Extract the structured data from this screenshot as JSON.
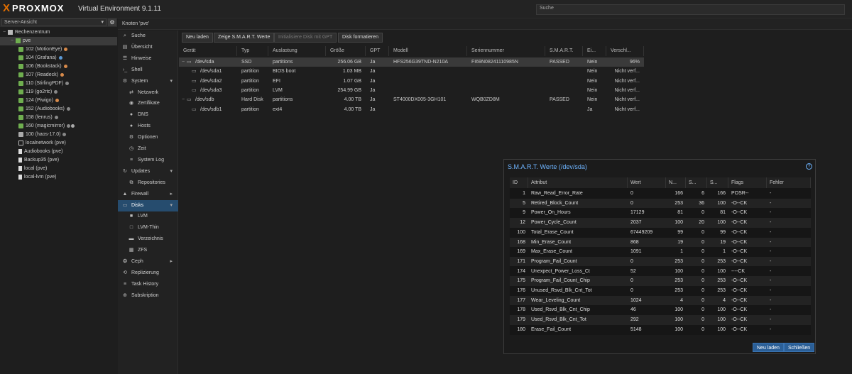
{
  "app": {
    "logo_text": "PROXMOX",
    "logo_mark": "X",
    "version": "Virtual Environment 9.1.11",
    "search_placeholder": "Suche"
  },
  "tree": {
    "view_select": "Server-Ansicht",
    "items": [
      {
        "label": "Rechenzentrum",
        "icon": "datacenter-icon",
        "indent": 0
      },
      {
        "label": "pve",
        "icon": "node-icon",
        "indent": 1,
        "selected": true
      },
      {
        "label": "102 (MotionEye)",
        "icon": "container-icon",
        "indent": 2,
        "dot": "#d88a4a"
      },
      {
        "label": "104 (Grafana)",
        "icon": "container-icon",
        "indent": 2,
        "dot": "#5c9ad6"
      },
      {
        "label": "106 (Bookstack)",
        "icon": "container-icon",
        "indent": 2,
        "dot": "#d88a4a"
      },
      {
        "label": "107 (Readeck)",
        "icon": "container-icon",
        "indent": 2,
        "dot": "#d88a4a"
      },
      {
        "label": "110 (StirlingPDF)",
        "icon": "container-icon",
        "indent": 2,
        "dot": "#888888"
      },
      {
        "label": "119 (go2rtc)",
        "icon": "container-icon",
        "indent": 2,
        "dot": "#888888"
      },
      {
        "label": "124 (Piwigo)",
        "icon": "container-icon",
        "indent": 2,
        "dot": "#d88a4a"
      },
      {
        "label": "152 (Audiobooks)",
        "icon": "container-icon",
        "indent": 2,
        "dot": "#888888"
      },
      {
        "label": "158 (fenrus)",
        "icon": "container-icon",
        "indent": 2,
        "dot": "#888888"
      },
      {
        "label": "160 (magicmirror)",
        "icon": "container-icon",
        "indent": 2,
        "dot": "#888888",
        "dot2": "#aaaaaa"
      },
      {
        "label": "100 (haos-17.0)",
        "icon": "vm-icon",
        "indent": 2,
        "dot": "#888888"
      },
      {
        "label": "localnetwork (pve)",
        "icon": "network-icon",
        "indent": 2
      },
      {
        "label": "Audiobooks (pve)",
        "icon": "storage-icon",
        "indent": 2
      },
      {
        "label": "Backup35 (pve)",
        "icon": "storage-icon",
        "indent": 2
      },
      {
        "label": "local (pve)",
        "icon": "storage-icon",
        "indent": 2
      },
      {
        "label": "local-lvm (pve)",
        "icon": "storage-icon",
        "indent": 2
      }
    ]
  },
  "nav": {
    "title": "Knoten 'pve'",
    "items": [
      {
        "label": "Suche",
        "icon": "search-icon",
        "sub": false
      },
      {
        "label": "Übersicht",
        "icon": "summary-icon",
        "sub": false
      },
      {
        "label": "Hinweise",
        "icon": "notes-icon",
        "sub": false
      },
      {
        "label": "Shell",
        "icon": "terminal-icon",
        "sub": false
      },
      {
        "label": "System",
        "icon": "gear-icon",
        "sub": false,
        "chevron": "down"
      },
      {
        "label": "Netzwerk",
        "icon": "network-icon",
        "sub": true
      },
      {
        "label": "Zertifikate",
        "icon": "certificate-icon",
        "sub": true
      },
      {
        "label": "DNS",
        "icon": "globe-icon",
        "sub": true
      },
      {
        "label": "Hosts",
        "icon": "globe-icon",
        "sub": true
      },
      {
        "label": "Optionen",
        "icon": "gear-icon",
        "sub": true
      },
      {
        "label": "Zeit",
        "icon": "clock-icon",
        "sub": true
      },
      {
        "label": "System Log",
        "icon": "list-icon",
        "sub": true
      },
      {
        "label": "Updates",
        "icon": "refresh-icon",
        "sub": false,
        "chevron": "down"
      },
      {
        "label": "Repositories",
        "icon": "repository-icon",
        "sub": true
      },
      {
        "label": "Firewall",
        "icon": "shield-icon",
        "sub": false,
        "chevron": "right"
      },
      {
        "label": "Disks",
        "icon": "disk-icon",
        "sub": false,
        "chevron": "down",
        "selected": true
      },
      {
        "label": "LVM",
        "icon": "square-icon",
        "sub": true
      },
      {
        "label": "LVM-Thin",
        "icon": "square-outline-icon",
        "sub": true
      },
      {
        "label": "Verzeichnis",
        "icon": "folder-icon",
        "sub": true
      },
      {
        "label": "ZFS",
        "icon": "grid-icon",
        "sub": true
      },
      {
        "label": "Ceph",
        "icon": "ceph-icon",
        "sub": false,
        "chevron": "right"
      },
      {
        "label": "Replizierung",
        "icon": "replicate-icon",
        "sub": false
      },
      {
        "label": "Task History",
        "icon": "list-icon",
        "sub": false
      },
      {
        "label": "Subskription",
        "icon": "support-icon",
        "sub": false
      }
    ]
  },
  "toolbar": {
    "reload": "Neu laden",
    "show_smart": "Zeige S.M.A.R.T. Werte",
    "init_gpt": "Initialisiere Disk mit GPT",
    "wipe": "Disk formatieren"
  },
  "disks": {
    "columns": [
      "Gerät",
      "Typ",
      "Auslastung",
      "Größe",
      "GPT",
      "Modell",
      "Seriennummer",
      "S.M.A.R.T.",
      "Ei...",
      "Verschl..."
    ],
    "rows": [
      {
        "level": 0,
        "device": "/dev/sda",
        "type": "SSD",
        "usage": "partitions",
        "size": "256.06 GB",
        "gpt": "Ja",
        "model": "HFS256G39TND-N210A",
        "serial": "FI69N08241110985N",
        "smart": "PASSED",
        "mounted": "Nein",
        "wear": "96%",
        "selected": true
      },
      {
        "level": 1,
        "device": "/dev/sda1",
        "type": "partition",
        "usage": "BIOS boot",
        "size": "1.03 MB",
        "gpt": "Ja",
        "model": "",
        "serial": "",
        "smart": "",
        "mounted": "Nein",
        "wear": "Nicht verf..."
      },
      {
        "level": 1,
        "device": "/dev/sda2",
        "type": "partition",
        "usage": "EFI",
        "size": "1.07 GB",
        "gpt": "Ja",
        "model": "",
        "serial": "",
        "smart": "",
        "mounted": "Nein",
        "wear": "Nicht verf..."
      },
      {
        "level": 1,
        "device": "/dev/sda3",
        "type": "partition",
        "usage": "LVM",
        "size": "254.99 GB",
        "gpt": "Ja",
        "model": "",
        "serial": "",
        "smart": "",
        "mounted": "Nein",
        "wear": "Nicht verf..."
      },
      {
        "level": 0,
        "device": "/dev/sdb",
        "type": "Hard Disk",
        "usage": "partitions",
        "size": "4.00 TB",
        "gpt": "Ja",
        "model": "ST4000DX005-3GH101",
        "serial": "WQB0ZD8M",
        "smart": "PASSED",
        "mounted": "Nein",
        "wear": "Nicht verf..."
      },
      {
        "level": 1,
        "device": "/dev/sdb1",
        "type": "partition",
        "usage": "ext4",
        "size": "4.00 TB",
        "gpt": "Ja",
        "model": "",
        "serial": "",
        "smart": "",
        "mounted": "Ja",
        "wear": "Nicht verf..."
      }
    ]
  },
  "smart_dialog": {
    "title": "S.M.A.R.T. Werte (/dev/sda)",
    "help": "?",
    "columns": [
      "ID",
      "Attribut",
      "Wert",
      "N...",
      "S...",
      "S...",
      "Flags",
      "Fehler"
    ],
    "rows": [
      [
        "1",
        "Raw_Read_Error_Rate",
        "0",
        "166",
        "6",
        "166",
        "POSR--",
        "-"
      ],
      [
        "5",
        "Retired_Block_Count",
        "0",
        "253",
        "36",
        "100",
        "-O--CK",
        "-"
      ],
      [
        "9",
        "Power_On_Hours",
        "17129",
        "81",
        "0",
        "81",
        "-O--CK",
        "-"
      ],
      [
        "12",
        "Power_Cycle_Count",
        "2037",
        "100",
        "20",
        "100",
        "-O--CK",
        "-"
      ],
      [
        "100",
        "Total_Erase_Count",
        "67449209",
        "99",
        "0",
        "99",
        "-O--CK",
        "-"
      ],
      [
        "168",
        "Min_Erase_Count",
        "868",
        "19",
        "0",
        "19",
        "-O--CK",
        "-"
      ],
      [
        "169",
        "Max_Erase_Count",
        "1091",
        "1",
        "0",
        "1",
        "-O--CK",
        "-"
      ],
      [
        "171",
        "Program_Fail_Count",
        "0",
        "253",
        "0",
        "253",
        "-O--CK",
        "-"
      ],
      [
        "174",
        "Unexpect_Power_Loss_Ct",
        "52",
        "100",
        "0",
        "100",
        "----CK",
        "-"
      ],
      [
        "175",
        "Program_Fail_Count_Chip",
        "0",
        "253",
        "0",
        "253",
        "-O--CK",
        "-"
      ],
      [
        "176",
        "Unused_Rsvd_Blk_Cnt_Tot",
        "0",
        "253",
        "0",
        "253",
        "-O--CK",
        "-"
      ],
      [
        "177",
        "Wear_Leveling_Count",
        "1024",
        "4",
        "0",
        "4",
        "-O--CK",
        "-"
      ],
      [
        "178",
        "Used_Rsvd_Blk_Cnt_Chip",
        "46",
        "100",
        "0",
        "100",
        "-O--CK",
        "-"
      ],
      [
        "179",
        "Used_Rsvd_Blk_Cnt_Tot",
        "292",
        "100",
        "0",
        "100",
        "-O--CK",
        "-"
      ],
      [
        "180",
        "Erase_Fail_Count",
        "5148",
        "100",
        "0",
        "100",
        "-O--CK",
        "-"
      ]
    ],
    "reload": "Neu laden",
    "close": "Schließen"
  },
  "colors": {
    "accent": "#3a74b3",
    "selected_nav": "#264c6e",
    "brand_orange": "#e57000",
    "link_blue": "#6eb4ff"
  }
}
